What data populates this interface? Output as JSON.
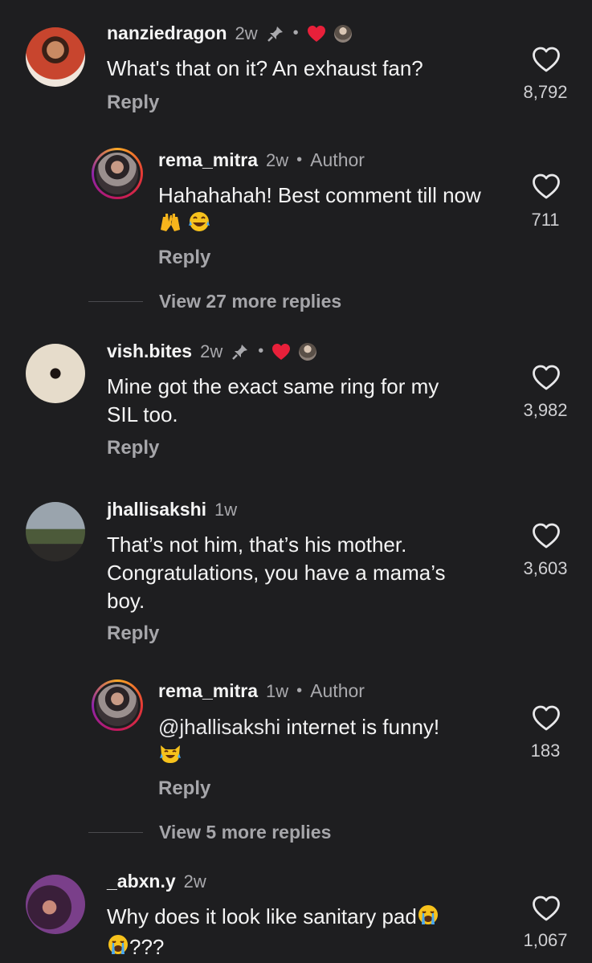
{
  "comments": [
    {
      "username": "nanziedragon",
      "time": "2w",
      "text": "What's that on it? An exhaust fan?",
      "reply": "Reply",
      "likes": "8,792",
      "avatar_color": "#b23a2a"
    },
    {
      "username": "rema_mitra",
      "time": "2w",
      "badge": "Author",
      "text": "Hahahahah! Best comment till now",
      "reply": "Reply",
      "likes": "711",
      "view_more": "View 27 more replies"
    },
    {
      "username": "vish.bites",
      "time": "2w",
      "text_line1": "Mine got the exact same ring for my",
      "text_line2": "SIL too.",
      "reply": "Reply",
      "likes": "3,982"
    },
    {
      "username": "jhallisakshi",
      "time": "1w",
      "text_line1": "That’s not him, that’s his mother.",
      "text_line2": "Congratulations, you have a mama’s",
      "text_line3": "boy.",
      "reply": "Reply",
      "likes": "3,603"
    },
    {
      "username": "rema_mitra",
      "time": "1w",
      "badge": "Author",
      "mention": "@jhallisakshi",
      "text": " internet is funny!",
      "reply": "Reply",
      "likes": "183",
      "view_more": "View 5 more replies"
    },
    {
      "username": "_abxn.y",
      "time": "2w",
      "text": "Why does it look like sanitary pad",
      "text_tail": "???",
      "likes": "1,067"
    }
  ],
  "colors": {
    "background": "#1e1e20",
    "heart_red": "#e8203a",
    "secondary_text": "#a9a9ad"
  },
  "icons": {
    "like": "heart-outline-icon",
    "pin": "pin-icon",
    "liked_by_author": "heart-filled-icon"
  }
}
